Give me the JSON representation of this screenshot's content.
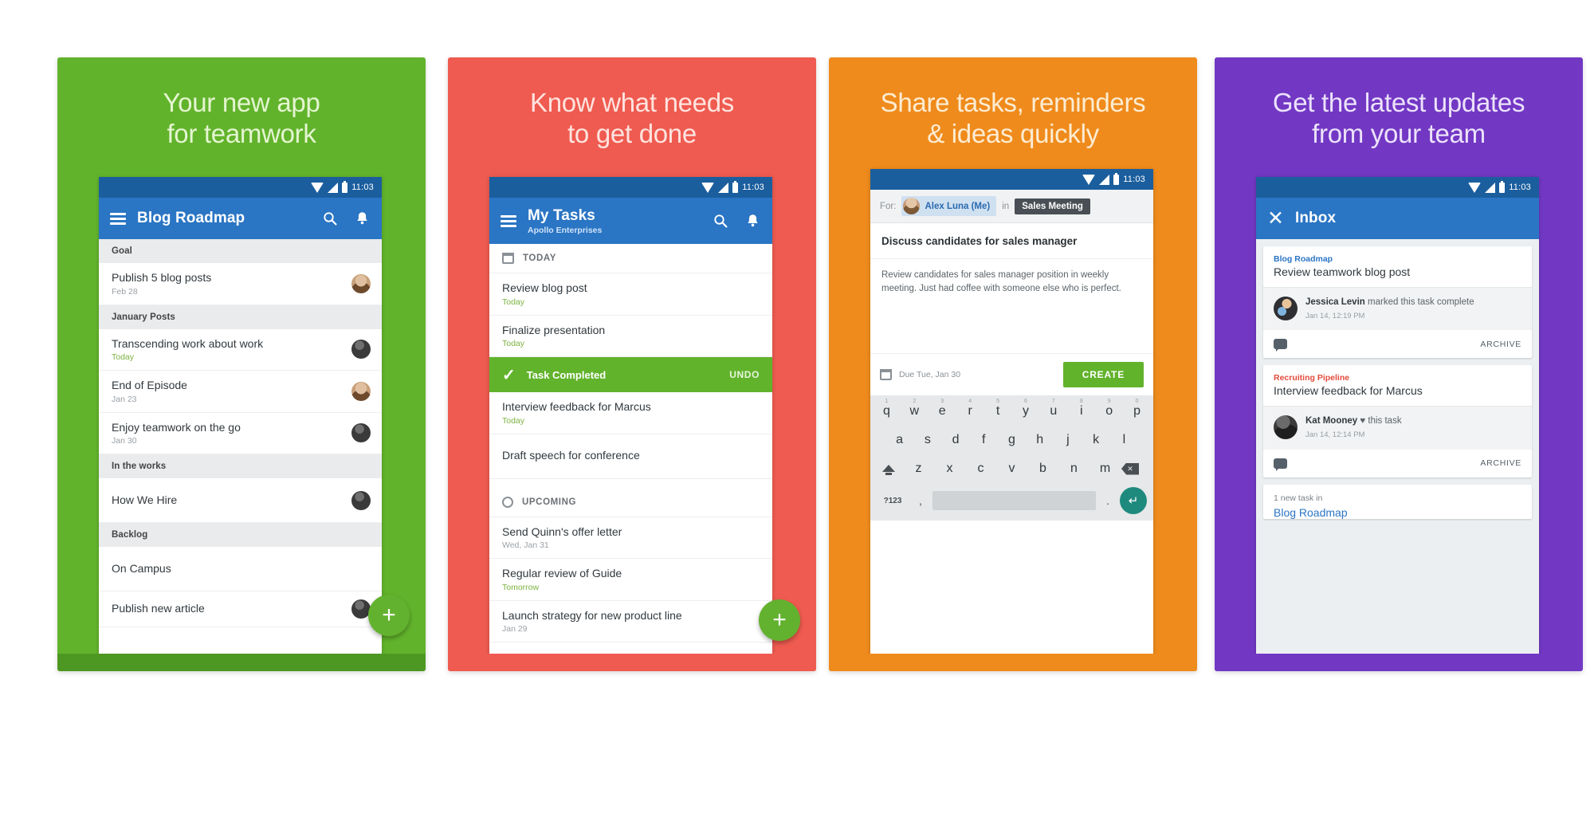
{
  "status_bar": {
    "time": "11:03",
    "icons": [
      "wifi-icon",
      "signal-icon",
      "battery-icon"
    ]
  },
  "colors": {
    "green": "#62b32c",
    "red": "#ef5b50",
    "orange": "#ef8b1c",
    "purple": "#7238c4",
    "appbar_blue": "#2a75c4",
    "statusbar_blue": "#1b5e9e",
    "accent_green": "#63b22f"
  },
  "panels": [
    {
      "headline_line1": "Your new app",
      "headline_line2": "for teamwork",
      "appbar": {
        "title": "Blog Roadmap",
        "subtitle": "",
        "menu": "menu-icon",
        "search": "search-icon",
        "bell": "notifications-icon"
      },
      "fab_label": "+",
      "sections": [
        {
          "header": "Goal",
          "items": [
            {
              "title": "Publish 5 blog posts",
              "sub": "Feb 28",
              "sub_style": "muted",
              "avatar": "tan"
            }
          ]
        },
        {
          "header": "January Posts",
          "items": [
            {
              "title": "Transcending work about work",
              "sub": "Today",
              "sub_style": "today",
              "avatar": "dark"
            },
            {
              "title": "End of Episode",
              "sub": "Jan 23",
              "sub_style": "muted",
              "avatar": "tan"
            },
            {
              "title": "Enjoy teamwork on the go",
              "sub": "Jan 30",
              "sub_style": "muted",
              "avatar": "dark"
            }
          ]
        },
        {
          "header": "In the works",
          "items": [
            {
              "title": "How We Hire",
              "sub": "",
              "sub_style": "muted",
              "avatar": "dark"
            }
          ]
        },
        {
          "header": "Backlog",
          "items": [
            {
              "title": "On Campus",
              "sub": "",
              "sub_style": "muted",
              "avatar": ""
            },
            {
              "title": "Publish new article",
              "sub": "",
              "sub_style": "muted",
              "avatar": "dark"
            }
          ]
        }
      ]
    },
    {
      "headline_line1": "Know what needs",
      "headline_line2": "to get done",
      "appbar": {
        "title": "My Tasks",
        "subtitle": "Apollo Enterprises",
        "menu": "menu-icon",
        "search": "search-icon",
        "bell": "notifications-icon"
      },
      "fab_label": "+",
      "today_label": "TODAY",
      "upcoming_label": "UPCOMING",
      "snackbar": {
        "message": "Task Completed",
        "action": "UNDO",
        "check": "check-icon"
      },
      "today_items": [
        {
          "title": "Review blog post",
          "sub": "Today",
          "sub_style": "today"
        },
        {
          "title": "Finalize presentation",
          "sub": "Today",
          "sub_style": "today"
        }
      ],
      "today_items_after": [
        {
          "title": "Interview feedback for Marcus",
          "sub": "Today",
          "sub_style": "today"
        },
        {
          "title": "Draft speech for conference",
          "sub": "",
          "sub_style": "muted"
        }
      ],
      "upcoming_items": [
        {
          "title": "Send Quinn's offer letter",
          "sub": "Wed, Jan 31",
          "sub_style": "muted"
        },
        {
          "title": "Regular review of Guide",
          "sub": "Tomorrow",
          "sub_style": "tomorrow"
        },
        {
          "title": "Launch strategy for new product line",
          "sub": "Jan 29",
          "sub_style": "muted"
        }
      ]
    },
    {
      "headline_line1": "Share tasks, reminders",
      "headline_line2": "& ideas quickly",
      "composer": {
        "for_label": "For:",
        "assignee": "Alex Luna (Me)",
        "in_label": "in",
        "project": "Sales Meeting",
        "task_name": "Discuss candidates for sales manager",
        "notes": "Review candidates for sales manager position in weekly meeting. Just had coffee with someone else who is perfect.",
        "due_text": "Due Tue, Jan 30",
        "due_icon": "calendar-icon",
        "create_label": "CREATE"
      },
      "keyboard": {
        "row1": [
          "q",
          "w",
          "e",
          "r",
          "t",
          "y",
          "u",
          "i",
          "o",
          "p"
        ],
        "row1_alt": [
          "1",
          "2",
          "3",
          "4",
          "5",
          "6",
          "7",
          "8",
          "9",
          "0"
        ],
        "row2": [
          "a",
          "s",
          "d",
          "f",
          "g",
          "h",
          "j",
          "k",
          "l"
        ],
        "row3": [
          "z",
          "x",
          "c",
          "v",
          "b",
          "n",
          "m"
        ],
        "shift": "shift-icon",
        "backspace": "backspace-icon",
        "num_key": "?123",
        "comma": ",",
        "period": ".",
        "enter": "enter-icon"
      }
    },
    {
      "headline_line1": "Get the latest updates",
      "headline_line2": "from your team",
      "appbar": {
        "title": "Inbox",
        "close": "close-icon"
      },
      "cards": [
        {
          "project": "Blog Roadmap",
          "project_color": "blue",
          "task": "Review teamwork blog post",
          "actor": "Jessica Levin",
          "action": " marked this task complete",
          "time": "Jan 14, 12:19 PM",
          "avatar": "jessica",
          "chat_icon": "comment-icon",
          "archive_label": "ARCHIVE"
        },
        {
          "project": "Recruiting Pipeline",
          "project_color": "red",
          "task": "Interview feedback for Marcus",
          "actor": "Kat Mooney",
          "action": " ♥ this task",
          "time": "Jan 14, 12:14 PM",
          "avatar": "kat",
          "chat_icon": "comment-icon",
          "archive_label": "ARCHIVE"
        }
      ],
      "peek": {
        "sub": "1 new task in",
        "title": "Blog Roadmap"
      }
    }
  ]
}
